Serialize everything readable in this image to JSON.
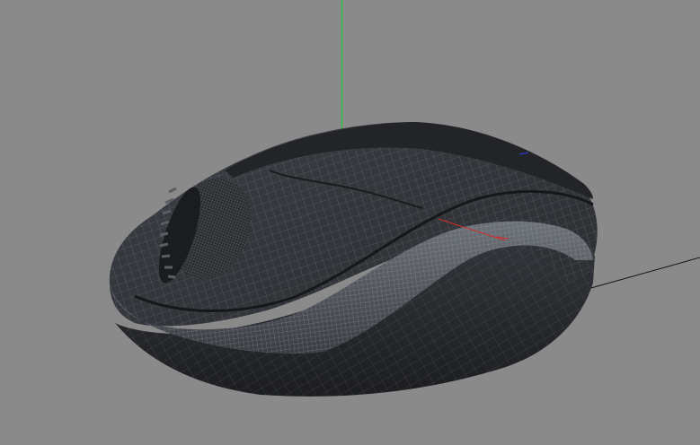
{
  "viewport": {
    "background": "#8a8a8a",
    "shading": "wireframe-on-shaded"
  },
  "scene": {
    "object": "computer-mouse",
    "body_color": "#2f3136",
    "wire_color": "#8c9097",
    "axes": {
      "y_color": "#16c83a",
      "x_color": "#d12c2c",
      "z_color": "#2a38c9",
      "ground_line_color": "#141414"
    }
  }
}
